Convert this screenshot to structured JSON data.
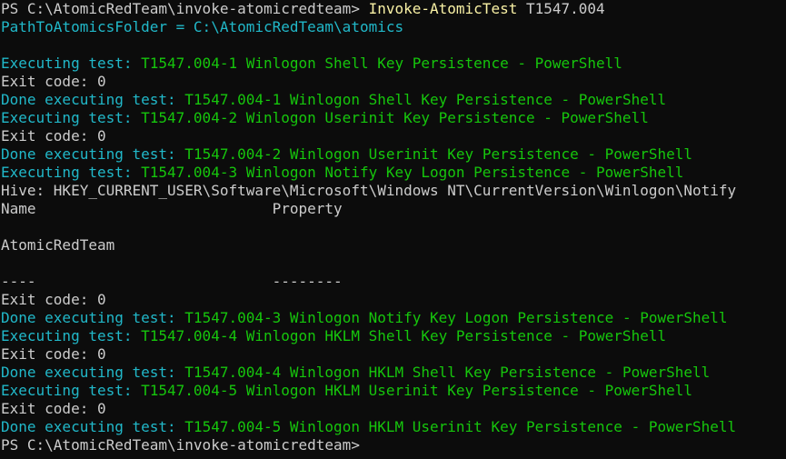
{
  "colors": {
    "background": "#0c0c0c",
    "default": "#cccccc",
    "cyan": "#21b8c9",
    "green": "#16c60c",
    "yellow": "#f9f1a5"
  },
  "lines": [
    [
      {
        "text": "PS C:\\AtomicRedTeam\\invoke-atomicredteam> ",
        "color": "default"
      },
      {
        "text": "Invoke-AtomicTest",
        "color": "yellow"
      },
      {
        "text": " T1547.004",
        "color": "default"
      }
    ],
    [
      {
        "text": "PathToAtomicsFolder = C:\\AtomicRedTeam\\atomics",
        "color": "cyan"
      }
    ],
    [],
    [
      {
        "text": "Executing test: ",
        "color": "cyan"
      },
      {
        "text": "T1547.004-1 Winlogon Shell Key Persistence - PowerShell",
        "color": "green"
      }
    ],
    [
      {
        "text": "Exit code: 0",
        "color": "default"
      }
    ],
    [
      {
        "text": "Done executing test: ",
        "color": "cyan"
      },
      {
        "text": "T1547.004-1 Winlogon Shell Key Persistence - PowerShell",
        "color": "green"
      }
    ],
    [
      {
        "text": "Executing test: ",
        "color": "cyan"
      },
      {
        "text": "T1547.004-2 Winlogon Userinit Key Persistence - PowerShell",
        "color": "green"
      }
    ],
    [
      {
        "text": "Exit code: 0",
        "color": "default"
      }
    ],
    [
      {
        "text": "Done executing test: ",
        "color": "cyan"
      },
      {
        "text": "T1547.004-2 Winlogon Userinit Key Persistence - PowerShell",
        "color": "green"
      }
    ],
    [
      {
        "text": "Executing test: ",
        "color": "cyan"
      },
      {
        "text": "T1547.004-3 Winlogon Notify Key Logon Persistence - PowerShell",
        "color": "green"
      }
    ],
    [
      {
        "text": "Hive: HKEY_CURRENT_USER\\Software\\Microsoft\\Windows NT\\CurrentVersion\\Winlogon\\Notify",
        "color": "default"
      }
    ],
    [
      {
        "text": "Name                           Property",
        "color": "default"
      }
    ],
    [],
    [
      {
        "text": "AtomicRedTeam",
        "color": "default"
      }
    ],
    [],
    [
      {
        "text": "----                           --------",
        "color": "default"
      }
    ],
    [
      {
        "text": "Exit code: 0",
        "color": "default"
      }
    ],
    [
      {
        "text": "Done executing test: ",
        "color": "cyan"
      },
      {
        "text": "T1547.004-3 Winlogon Notify Key Logon Persistence - PowerShell",
        "color": "green"
      }
    ],
    [
      {
        "text": "Executing test: ",
        "color": "cyan"
      },
      {
        "text": "T1547.004-4 Winlogon HKLM Shell Key Persistence - PowerShell",
        "color": "green"
      }
    ],
    [
      {
        "text": "Exit code: 0",
        "color": "default"
      }
    ],
    [
      {
        "text": "Done executing test: ",
        "color": "cyan"
      },
      {
        "text": "T1547.004-4 Winlogon HKLM Shell Key Persistence - PowerShell",
        "color": "green"
      }
    ],
    [
      {
        "text": "Executing test: ",
        "color": "cyan"
      },
      {
        "text": "T1547.004-5 Winlogon HKLM Userinit Key Persistence - PowerShell",
        "color": "green"
      }
    ],
    [
      {
        "text": "Exit code: 0",
        "color": "default"
      }
    ],
    [
      {
        "text": "Done executing test: ",
        "color": "cyan"
      },
      {
        "text": "T1547.004-5 Winlogon HKLM Userinit Key Persistence - PowerShell",
        "color": "green"
      }
    ],
    [
      {
        "text": "PS C:\\AtomicRedTeam\\invoke-atomicredteam>",
        "color": "default"
      }
    ]
  ]
}
